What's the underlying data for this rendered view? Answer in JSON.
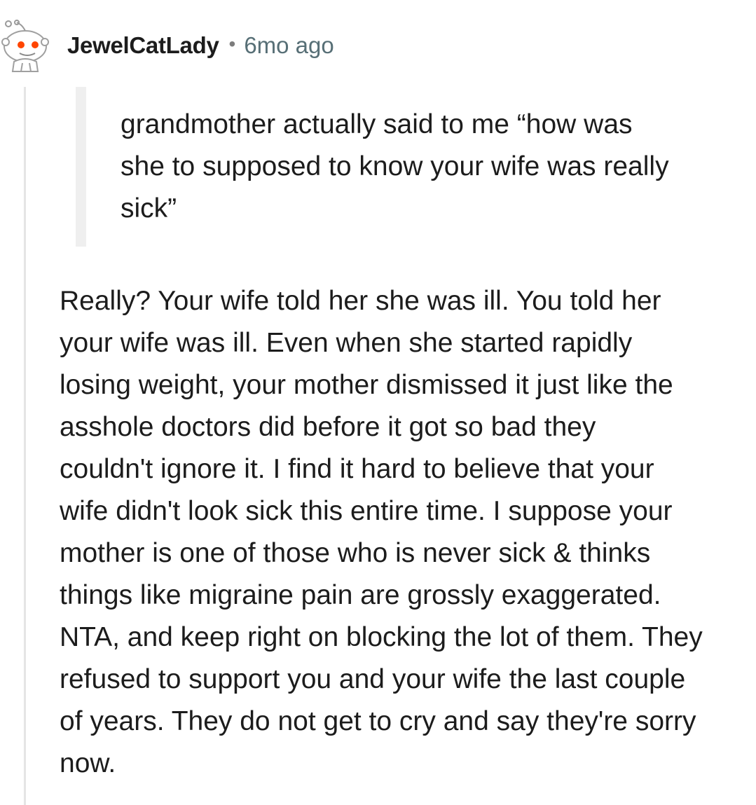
{
  "comment": {
    "author": "JewelCatLady",
    "separator": "•",
    "timestamp": "6mo ago",
    "avatar_icon": "reddit-snoo-avatar-icon",
    "quote": "grandmother actually said to me “how was\nshe to supposed to know your wife was really\nsick”",
    "body": "Really? Your wife told her she was ill. You told her\nyour wife was ill. Even when she started rapidly\nlosing weight, your mother dismissed it just like the\nasshole doctors did before it got so bad they\ncouldn't ignore it. I find it hard to believe that your\nwife didn't look sick this entire time. I suppose your\nmother is one of those who is never sick & thinks\nthings like migraine pain are grossly exaggerated.\nNTA, and keep right on blocking the lot of them. They\nrefused to support you and your wife the last couple\nof years. They do not get to cry and say they're sorry\nnow."
  },
  "colors": {
    "username": "#1c1c1c",
    "timestamp": "#576f76",
    "thread_line": "#e5e5e5",
    "quote_bar": "#efefef",
    "avatar_accent": "#ff4500"
  }
}
